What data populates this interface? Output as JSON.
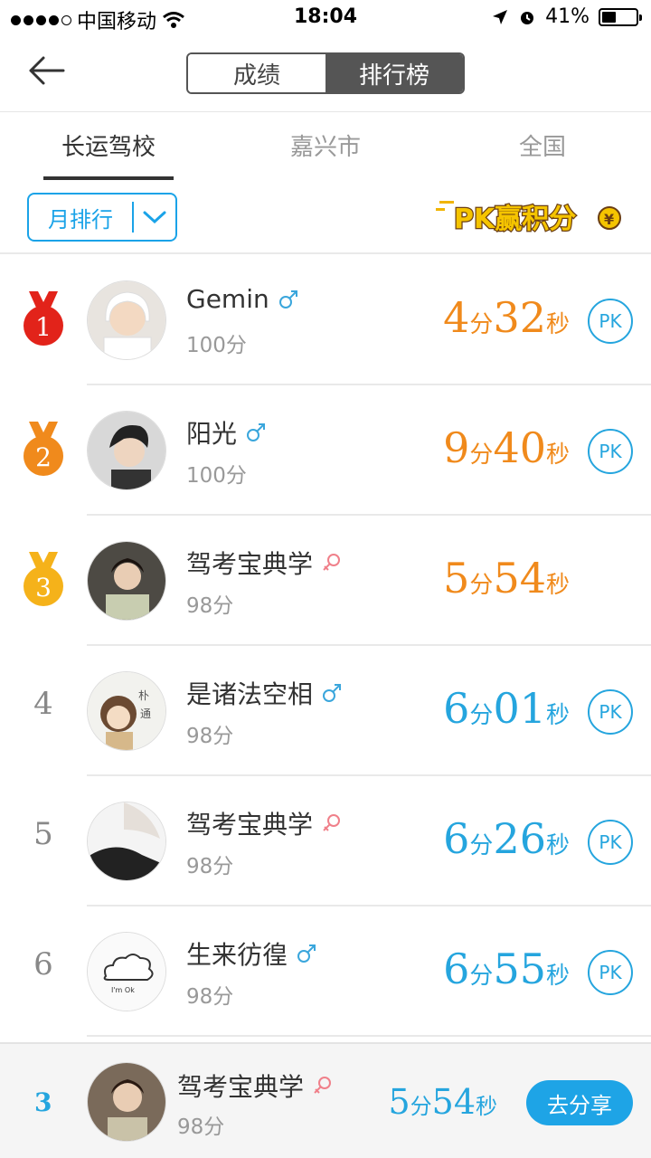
{
  "status_bar": {
    "carrier": "中国移动",
    "time": "18:04",
    "battery": "41%",
    "battery_level": 0.41
  },
  "header": {
    "segments": [
      "成绩",
      "排行榜"
    ],
    "active_segment": 1
  },
  "tabs": [
    "长运驾校",
    "嘉兴市",
    "全国"
  ],
  "active_tab": 0,
  "filter": {
    "label": "月排行"
  },
  "pk_banner": {
    "text": "PK赢积分"
  },
  "rows": [
    {
      "rank": "1",
      "name": "Gemin",
      "gender": "male",
      "score": "100分",
      "min": "4",
      "sec": "32",
      "color": "orange",
      "pk": "PK"
    },
    {
      "rank": "2",
      "name": "阳光",
      "gender": "male",
      "score": "100分",
      "min": "9",
      "sec": "40",
      "color": "orange",
      "pk": "PK"
    },
    {
      "rank": "3",
      "name": "驾考宝典学",
      "gender": "female",
      "score": "98分",
      "min": "5",
      "sec": "54",
      "color": "orange",
      "pk": ""
    },
    {
      "rank": "4",
      "name": "是诸法空相",
      "gender": "male",
      "score": "98分",
      "min": "6",
      "sec": "01",
      "color": "blue",
      "pk": "PK"
    },
    {
      "rank": "5",
      "name": "驾考宝典学",
      "gender": "female",
      "score": "98分",
      "min": "6",
      "sec": "26",
      "color": "blue",
      "pk": "PK"
    },
    {
      "rank": "6",
      "name": "生来彷徨",
      "gender": "male",
      "score": "98分",
      "min": "6",
      "sec": "55",
      "color": "blue",
      "pk": "PK"
    }
  ],
  "units": {
    "min": "分",
    "sec": "秒"
  },
  "footer": {
    "rank": "3",
    "name": "驾考宝典学",
    "gender": "female",
    "score": "98分",
    "min": "5",
    "sec": "54",
    "share_label": "去分享"
  },
  "colors": {
    "orange": "#f08a1c",
    "blue": "#25a5de",
    "medal_1": "#e2231a",
    "medal_2": "#f08a1c",
    "medal_3": "#f5b21a"
  }
}
